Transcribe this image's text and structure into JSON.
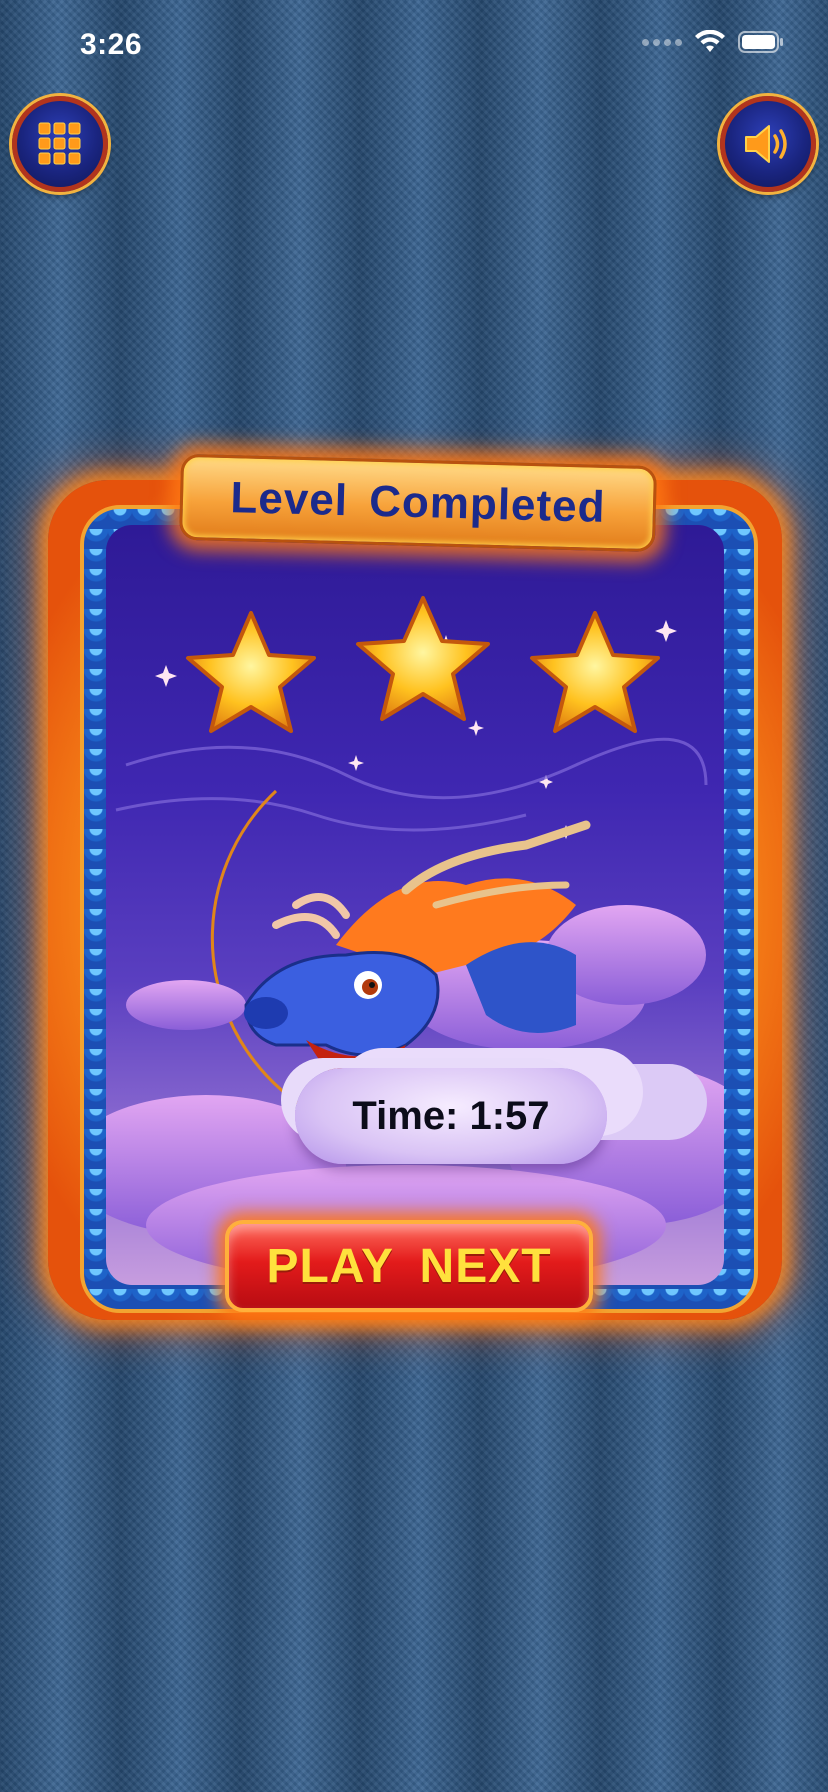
{
  "status_bar": {
    "time": "3:26"
  },
  "header": {
    "menu_icon": "grid-menu-icon",
    "sound_icon": "speaker-icon"
  },
  "dialog": {
    "title": "Level Completed",
    "stars_earned": 3,
    "stars_total": 3,
    "time_label": "Time: 1:57",
    "play_next_label": "PLAY NEXT"
  },
  "colors": {
    "title_text": "#1b2a8c",
    "button_text": "#ffe13d",
    "button_red": "#e31b1b",
    "star": "#ffc21f"
  }
}
